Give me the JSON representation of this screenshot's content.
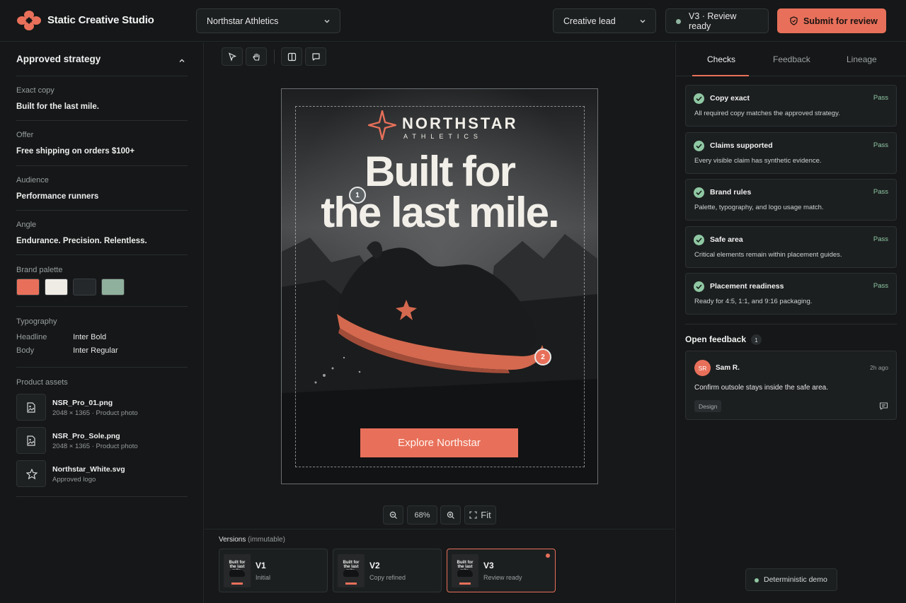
{
  "app": {
    "title": "Static Creative Studio"
  },
  "header": {
    "client": "Northstar Athletics",
    "role": "Creative lead",
    "status": "V3 · Review ready",
    "submit_label": "Submit for review"
  },
  "strategy": {
    "heading": "Approved strategy",
    "fields": [
      {
        "label": "Exact copy",
        "value": "Built for the last mile."
      },
      {
        "label": "Offer",
        "value": "Free shipping on orders $100+"
      },
      {
        "label": "Audience",
        "value": "Performance runners"
      },
      {
        "label": "Angle",
        "value": "Endurance. Precision. Relentless."
      }
    ],
    "palette_label": "Brand palette",
    "palette": [
      "#e8705a",
      "#efece6",
      "#25282a",
      "#8fb09c"
    ],
    "typography_label": "Typography",
    "typography": [
      {
        "role": "Headline",
        "font": "Inter Bold"
      },
      {
        "role": "Body",
        "font": "Inter Regular"
      }
    ],
    "assets_label": "Product assets",
    "assets": [
      {
        "name": "NSR_Pro_01.png",
        "meta": "2048 × 1365 · Product photo",
        "icon": "image-file-icon"
      },
      {
        "name": "NSR_Pro_Sole.png",
        "meta": "2048 × 1365 · Product photo",
        "icon": "image-file-icon"
      },
      {
        "name": "Northstar_White.svg",
        "meta": "Approved logo",
        "icon": "star-icon"
      }
    ]
  },
  "canvas": {
    "brand_name": "NORTHSTAR",
    "brand_sub": "ATHLETICS",
    "headline_line1": "Built for",
    "headline_line2": "the last mile.",
    "cta": "Explore Northstar",
    "markers": [
      "1",
      "2"
    ],
    "zoom": "68%",
    "fit_label": "Fit"
  },
  "versions": {
    "title": "Versions",
    "note": "(immutable)",
    "items": [
      {
        "name": "V1",
        "sub": "Initial",
        "active": false,
        "thumb": "Built for the last mile."
      },
      {
        "name": "V2",
        "sub": "Copy refined",
        "active": false,
        "thumb": "Built for the last mile."
      },
      {
        "name": "V3",
        "sub": "Review ready",
        "active": true,
        "thumb": "Built for the last mile."
      }
    ]
  },
  "review": {
    "tabs": [
      "Checks",
      "Feedback",
      "Lineage"
    ],
    "active_tab": "Checks",
    "checks": [
      {
        "title": "Copy exact",
        "desc": "All required copy matches the approved strategy.",
        "result": "Pass"
      },
      {
        "title": "Claims supported",
        "desc": "Every visible claim has synthetic evidence.",
        "result": "Pass"
      },
      {
        "title": "Brand rules",
        "desc": "Palette, typography, and logo usage match.",
        "result": "Pass"
      },
      {
        "title": "Safe area",
        "desc": "Critical elements remain within placement guides.",
        "result": "Pass"
      },
      {
        "title": "Placement readiness",
        "desc": "Ready for 4:5, 1:1, and 9:16 packaging.",
        "result": "Pass"
      }
    ],
    "open_feedback_title": "Open feedback",
    "open_feedback_count": "1",
    "comment": {
      "initials": "SR",
      "author": "Sam R.",
      "time": "2h ago",
      "text": "Confirm outsole stays inside the safe area.",
      "tag": "Design"
    },
    "demo_label": "Deterministic demo"
  },
  "colors": {
    "accent": "#e8705a",
    "pass": "#8fc8a3",
    "background": "#141617"
  }
}
